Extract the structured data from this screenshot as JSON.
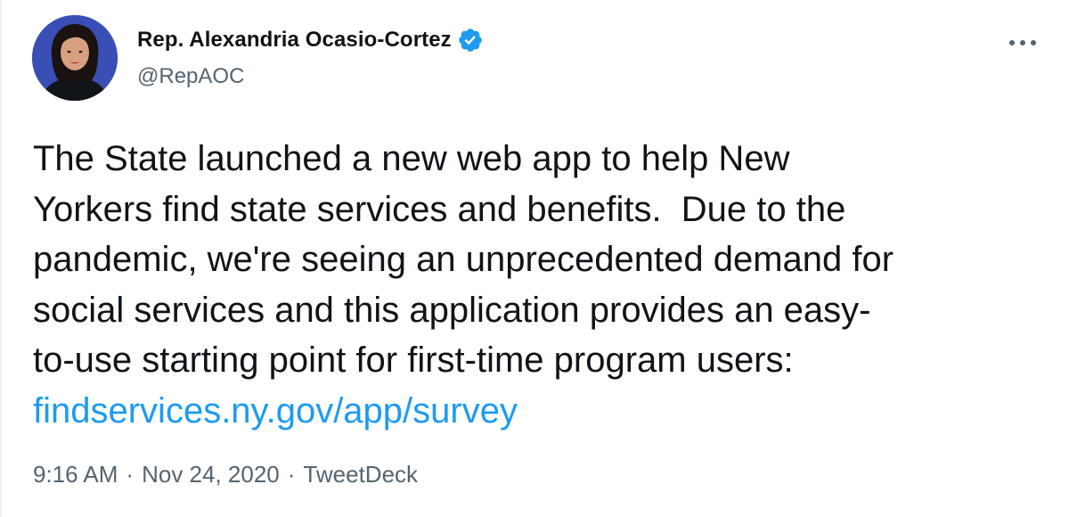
{
  "author": {
    "display_name": "Rep. Alexandria Ocasio-Cortez",
    "handle": "@RepAOC",
    "verified_icon": "verified-badge-icon",
    "avatar": "profile-photo"
  },
  "more_icon": "more-horizontal-icon",
  "tweet": {
    "lines": [
      "The State launched a new web app to help New",
      "Yorkers find state services and benefits.  Due to the",
      "pandemic, we're seeing an unprecedented demand for",
      "social services and this application provides an easy-",
      "to-use starting point for first-time program users:"
    ],
    "link_text": "findservices.ny.gov/app/survey"
  },
  "meta": {
    "time": "9:16 AM",
    "separator": "·",
    "date": "Nov 24, 2020",
    "source": "TweetDeck"
  },
  "colors": {
    "link": "#1d9bf0",
    "secondary_text": "#536471",
    "primary_text": "#0f1419",
    "verified": "#1d9bf0",
    "avatar_background": "#3a4fb6"
  }
}
